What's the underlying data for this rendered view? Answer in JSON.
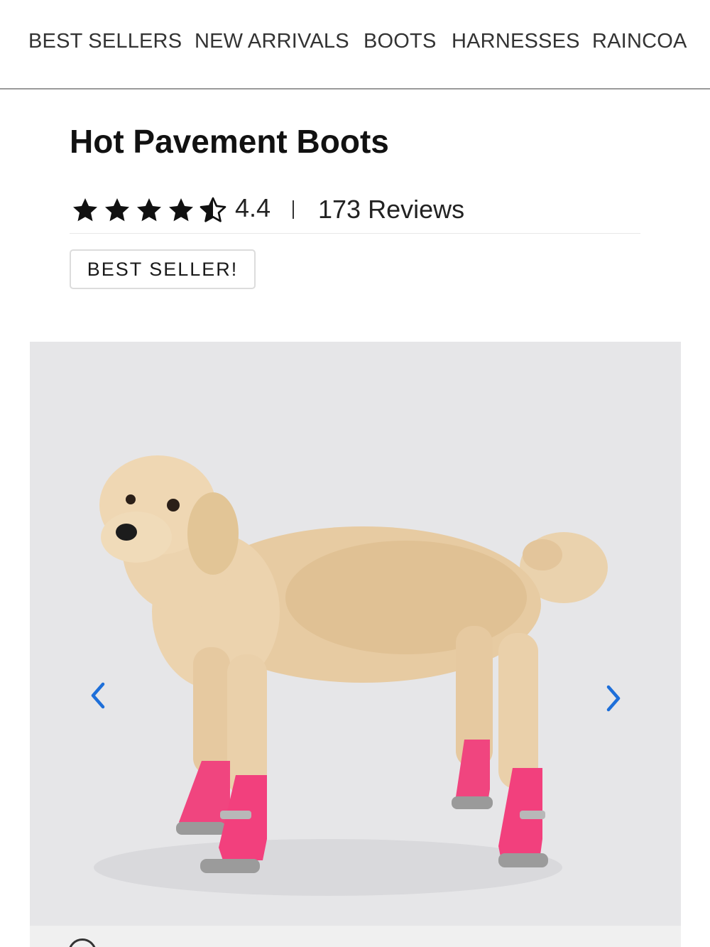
{
  "nav": {
    "items": [
      {
        "label": "BEST SELLERS"
      },
      {
        "label": "NEW ARRIVALS"
      },
      {
        "label": "BOOTS"
      },
      {
        "label": "HARNESSES"
      },
      {
        "label": "RAINCOA"
      }
    ]
  },
  "product": {
    "title": "Hot Pavement Boots",
    "rating": {
      "value": "4.4",
      "stars": 4.5,
      "reviews": "173 Reviews"
    },
    "badge": "BEST SELLER!"
  },
  "gallery": {
    "image": "dog-wearing-pink-boots",
    "prev_icon": "chevron-left-icon",
    "next_icon": "chevron-right-icon"
  },
  "colors": {
    "accent": "#1e6fd9",
    "boot_pink": "#f0457f",
    "gallery_bg": "#e6e6e8"
  }
}
